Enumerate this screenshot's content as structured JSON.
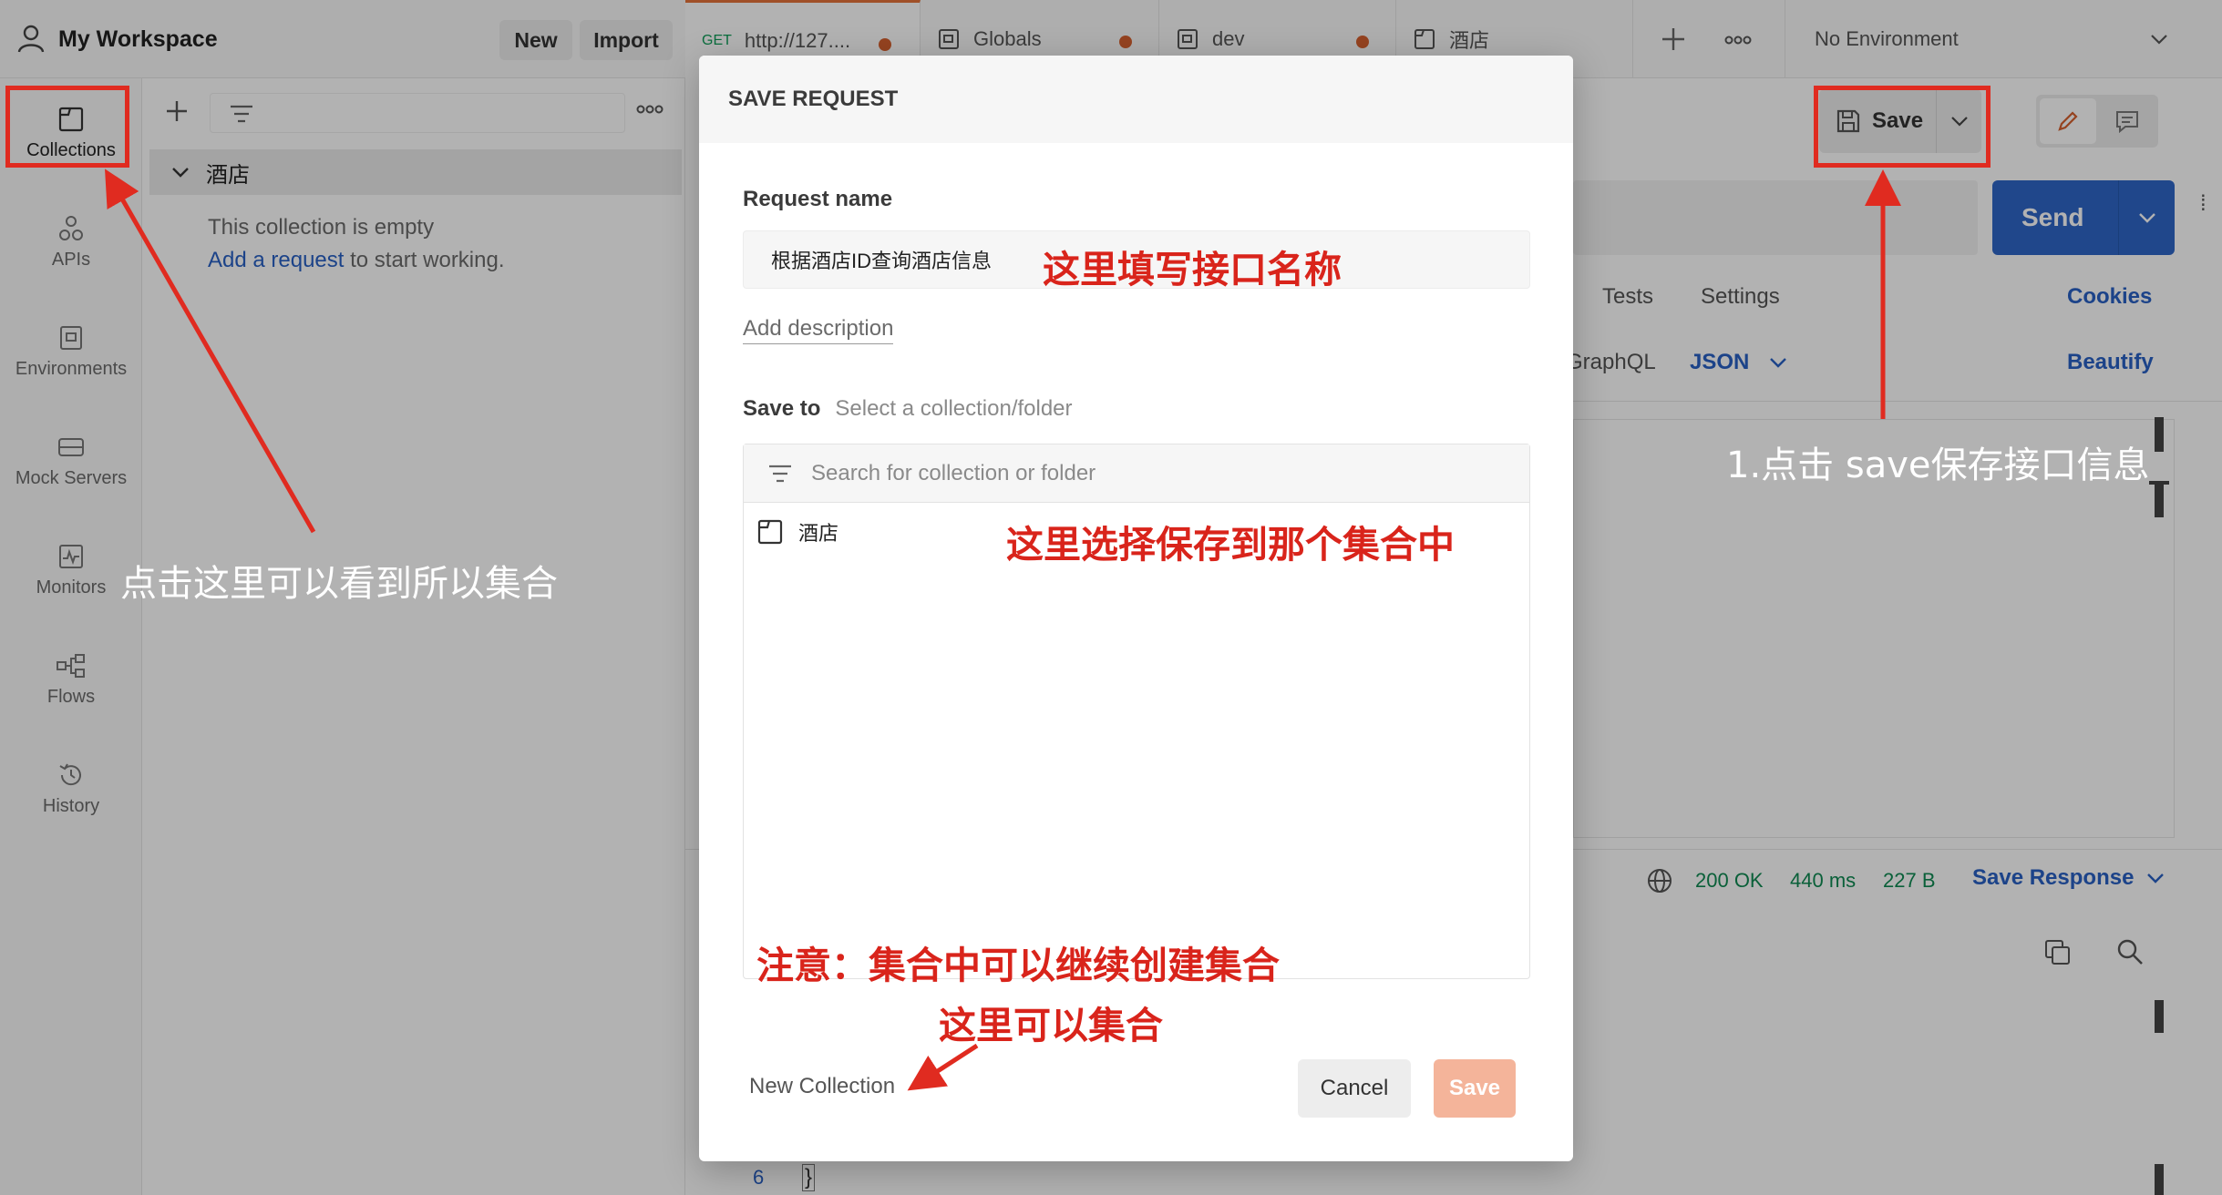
{
  "workspace": {
    "title": "My Workspace",
    "new_label": "New",
    "import_label": "Import"
  },
  "sidenav": {
    "items": [
      {
        "label": "Collections",
        "icon": "collections-icon"
      },
      {
        "label": "APIs",
        "icon": "apis-icon"
      },
      {
        "label": "Environments",
        "icon": "environments-icon"
      },
      {
        "label": "Mock Servers",
        "icon": "mock-servers-icon"
      },
      {
        "label": "Monitors",
        "icon": "monitors-icon"
      },
      {
        "label": "Flows",
        "icon": "flows-icon"
      },
      {
        "label": "History",
        "icon": "history-icon"
      }
    ]
  },
  "collections": {
    "tree_item": "酒店",
    "empty_text": "This collection is empty",
    "add_request_link": "Add a request",
    "add_request_suffix": " to start working."
  },
  "tabs": [
    {
      "method": "GET",
      "label": "http://127...."
    },
    {
      "label": "Globals"
    },
    {
      "label": "dev"
    },
    {
      "label": "酒店"
    }
  ],
  "environment": {
    "selected": "No Environment"
  },
  "request": {
    "save_label": "Save",
    "send_label": "Send",
    "tab_tests": "Tests",
    "tab_settings": "Settings",
    "cookies": "Cookies",
    "graphql": "GraphQL",
    "body_format": "JSON",
    "beautify": "Beautify",
    "line_number": "6",
    "brace": "}"
  },
  "response": {
    "status": "200 OK",
    "time": "440 ms",
    "size": "227 B",
    "save_response": "Save Response"
  },
  "modal": {
    "title": "SAVE REQUEST",
    "request_name_label": "Request name",
    "request_name_value": "根据酒店ID查询酒店信息",
    "add_description": "Add description",
    "save_to_label": "Save to",
    "save_to_hint": "Select a collection/folder",
    "search_placeholder": "Search for collection or folder",
    "list_items": [
      "酒店"
    ],
    "new_collection": "New Collection",
    "cancel_label": "Cancel",
    "save_label": "Save"
  },
  "annotations": {
    "name_hint": "这里填写接口名称",
    "collection_hint": "这里选择保存到那个集合中",
    "note": "注意：集合中可以继续创建集合",
    "new_collection_hint": "这里可以集合",
    "save_hint": "1.点击 save保存接口信息",
    "collections_hint": "点击这里可以看到所以集合"
  },
  "colors": {
    "accent_blue": "#2961c4",
    "send_button": "#2e66c7",
    "annotation_red": "#d9241b",
    "save_button_disabled": "#f4b49a",
    "modified_dot": "#d6602f"
  }
}
